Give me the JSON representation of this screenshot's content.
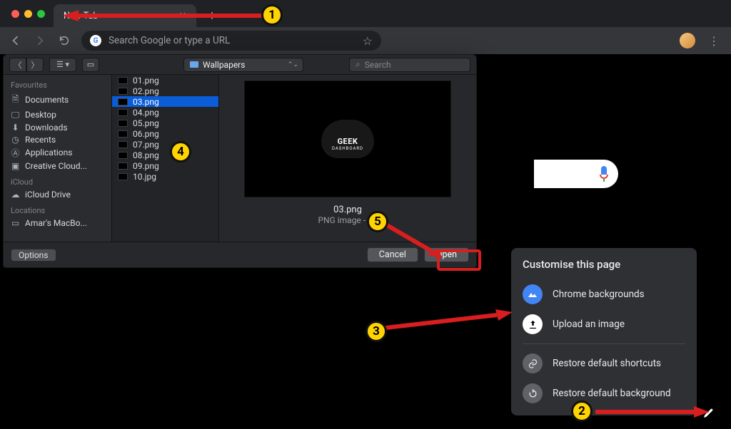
{
  "tab": {
    "title": "New Tab"
  },
  "omnibox": {
    "placeholder": "Search Google or type a URL"
  },
  "dialog": {
    "location": "Wallpapers",
    "searchPlaceholder": "Search",
    "headers": {
      "fav": "Favourites",
      "icloud": "iCloud",
      "loc": "Locations"
    },
    "sidebar": {
      "fav": [
        "Documents",
        "Desktop",
        "Downloads",
        "Recents",
        "Applications",
        "Creative Cloud..."
      ],
      "icloud": [
        "iCloud Drive"
      ],
      "loc": [
        "Amar's MacBo..."
      ]
    },
    "files": [
      "01.png",
      "02.png",
      "03.png",
      "04.png",
      "05.png",
      "06.png",
      "07.png",
      "08.png",
      "09.png",
      "10.jpg"
    ],
    "selectedIndex": 2,
    "preview": {
      "name": "03.png",
      "meta": "PNG image - 34",
      "logo1": "GEEK",
      "logo2": "DASHBOARD"
    },
    "buttons": {
      "options": "Options",
      "cancel": "Cancel",
      "open": "Open"
    }
  },
  "customise": {
    "title": "Customise this page",
    "items": {
      "backgrounds": "Chrome backgrounds",
      "upload": "Upload an image",
      "restoreShortcuts": "Restore default shortcuts",
      "restoreBackground": "Restore default background"
    }
  },
  "annotations": {
    "1": "1",
    "2": "2",
    "3": "3",
    "4": "4",
    "5": "5"
  }
}
